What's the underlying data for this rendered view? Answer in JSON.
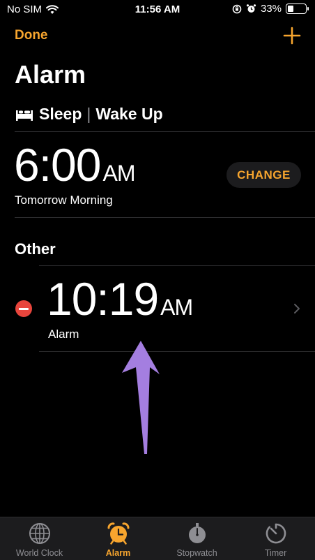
{
  "status_bar": {
    "carrier": "No SIM",
    "time": "11:56 AM",
    "battery": "33%",
    "battery_level": 0.33
  },
  "header": {
    "done_label": "Done",
    "title": "Alarm"
  },
  "sleep": {
    "sleep_label": "Sleep",
    "separator": "|",
    "wake_label": "Wake Up",
    "time": "6:00",
    "ampm": "AM",
    "subtitle": "Tomorrow Morning",
    "change_label": "CHANGE"
  },
  "other": {
    "section_title": "Other",
    "alarms": [
      {
        "time": "10:19",
        "ampm": "AM",
        "label": "Alarm"
      }
    ]
  },
  "tabs": [
    {
      "label": "World Clock",
      "icon": "globe-icon",
      "active": false
    },
    {
      "label": "Alarm",
      "icon": "alarm-clock-icon",
      "active": true
    },
    {
      "label": "Stopwatch",
      "icon": "stopwatch-icon",
      "active": false
    },
    {
      "label": "Timer",
      "icon": "timer-icon",
      "active": false
    }
  ],
  "colors": {
    "accent": "#f7a52e",
    "delete": "#e8453c",
    "annotation_arrow": "#a47ee0",
    "background": "#000000"
  }
}
